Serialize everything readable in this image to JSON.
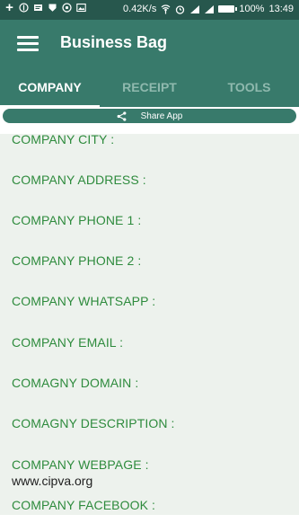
{
  "status_bar": {
    "speed": "0.42K/s",
    "battery": "100%",
    "time": "13:49"
  },
  "app": {
    "title": "Business Bag"
  },
  "tabs": [
    {
      "label": "COMPANY",
      "active": true
    },
    {
      "label": "RECEIPT",
      "active": false
    },
    {
      "label": "TOOLS",
      "active": false
    }
  ],
  "share": {
    "label": "Share App"
  },
  "fields": [
    {
      "label": "COMPANY CITY :",
      "value": ""
    },
    {
      "label": "COMPANY ADDRESS :",
      "value": ""
    },
    {
      "label": "COMPANY PHONE 1 :",
      "value": ""
    },
    {
      "label": "COMPANY PHONE 2 :",
      "value": ""
    },
    {
      "label": "COMPANY WHATSAPP :",
      "value": ""
    },
    {
      "label": "COMPANY EMAIL :",
      "value": ""
    },
    {
      "label": "COMAGNY DOMAIN :",
      "value": ""
    },
    {
      "label": "COMAGNY DESCRIPTION :",
      "value": ""
    },
    {
      "label": "COMPANY WEBPAGE :",
      "value": "www.cipva.org"
    },
    {
      "label": "COMPANY FACEBOOK :",
      "value": ""
    }
  ],
  "colors": {
    "status_bar": "#27574d",
    "app_bar": "#387a6b",
    "label": "#2e8b3d",
    "content_bg": "#edf2ed"
  },
  "icons": [
    "plus-icon",
    "bug-icon",
    "message-icon",
    "shield-icon",
    "whatsapp-icon",
    "image-icon",
    "wifi-icon",
    "alarm-icon",
    "signal-icon",
    "battery-icon",
    "menu-icon",
    "share-icon"
  ]
}
